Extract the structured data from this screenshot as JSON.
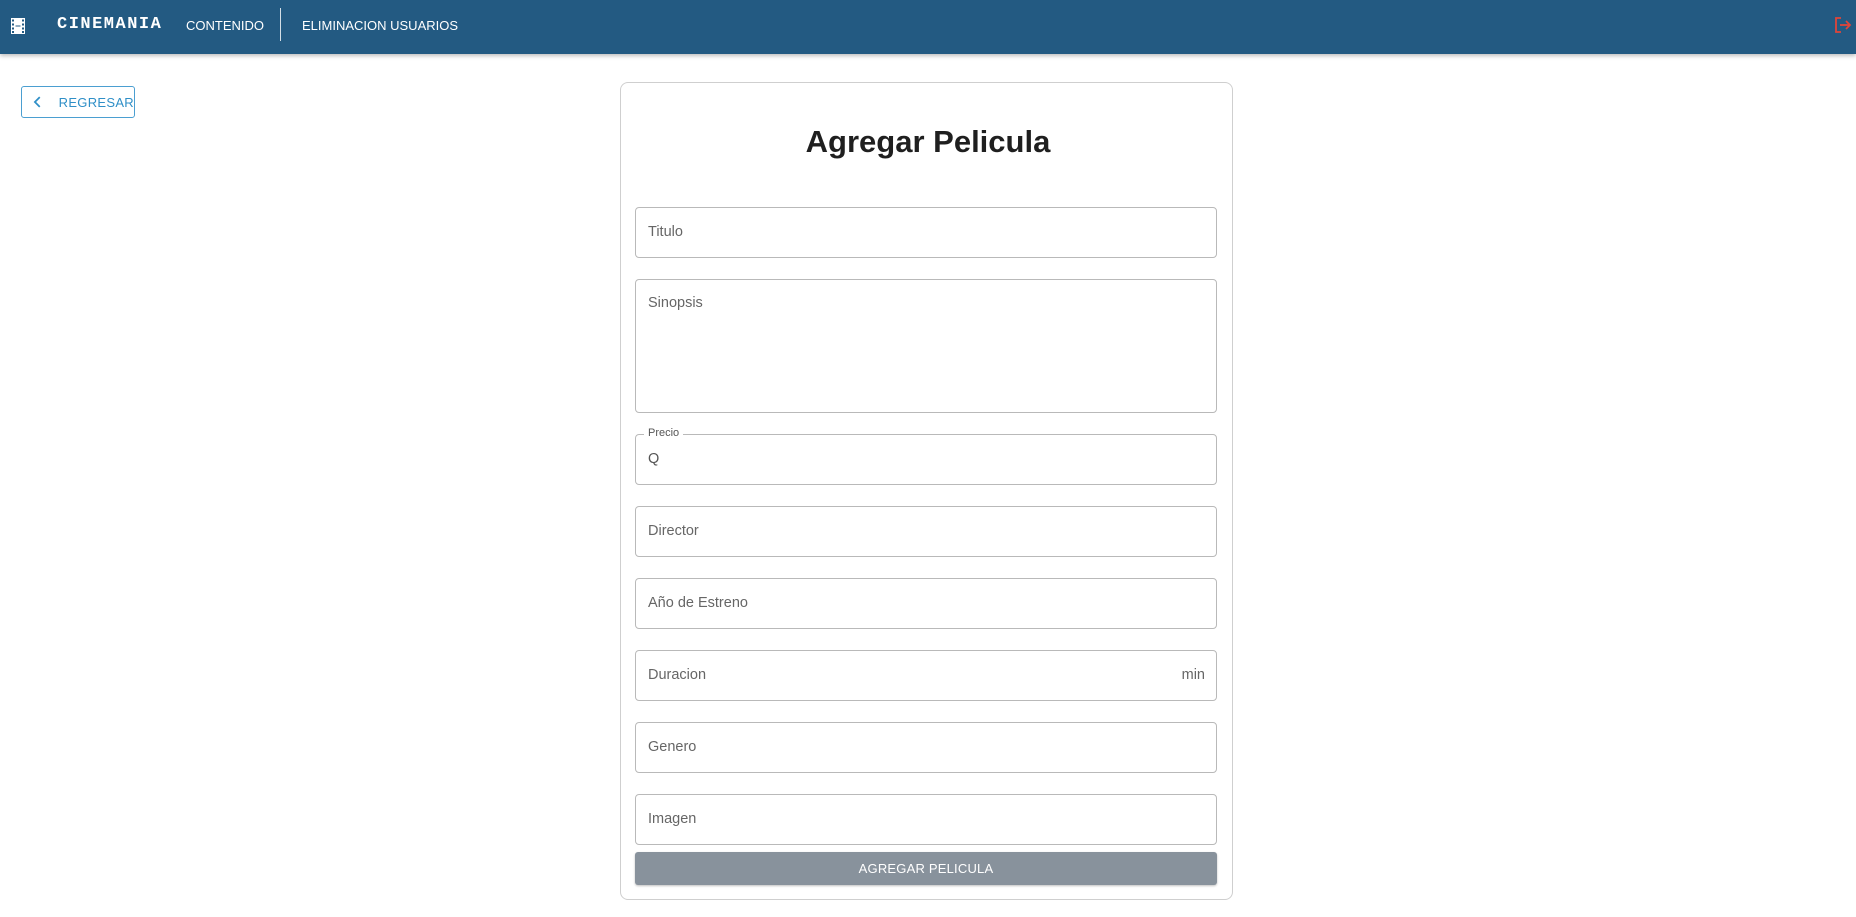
{
  "header": {
    "brand": "CINEMANIA",
    "nav": [
      "CONTENIDO",
      "ELIMINACION USUARIOS"
    ],
    "brand_icon": "film-icon",
    "logout_icon": "logout-icon",
    "background_color": "#235a82",
    "logout_color": "#e0453a"
  },
  "back_button": {
    "label": "REGRESAR",
    "icon": "chevron-left-icon"
  },
  "form": {
    "title": "Agregar Pelicula",
    "fields": {
      "titulo": {
        "placeholder": "Titulo"
      },
      "sinopsis": {
        "placeholder": "Sinopsis"
      },
      "precio": {
        "label": "Precio",
        "prefix": "Q"
      },
      "director": {
        "placeholder": "Director"
      },
      "anio": {
        "placeholder": "Año de Estreno"
      },
      "duracion": {
        "placeholder": "Duracion",
        "suffix": "min"
      },
      "genero": {
        "placeholder": "Genero"
      },
      "imagen": {
        "placeholder": "Imagen"
      }
    },
    "submit_label": "AGREGAR PELICULA",
    "submit_color": "#88929c"
  }
}
